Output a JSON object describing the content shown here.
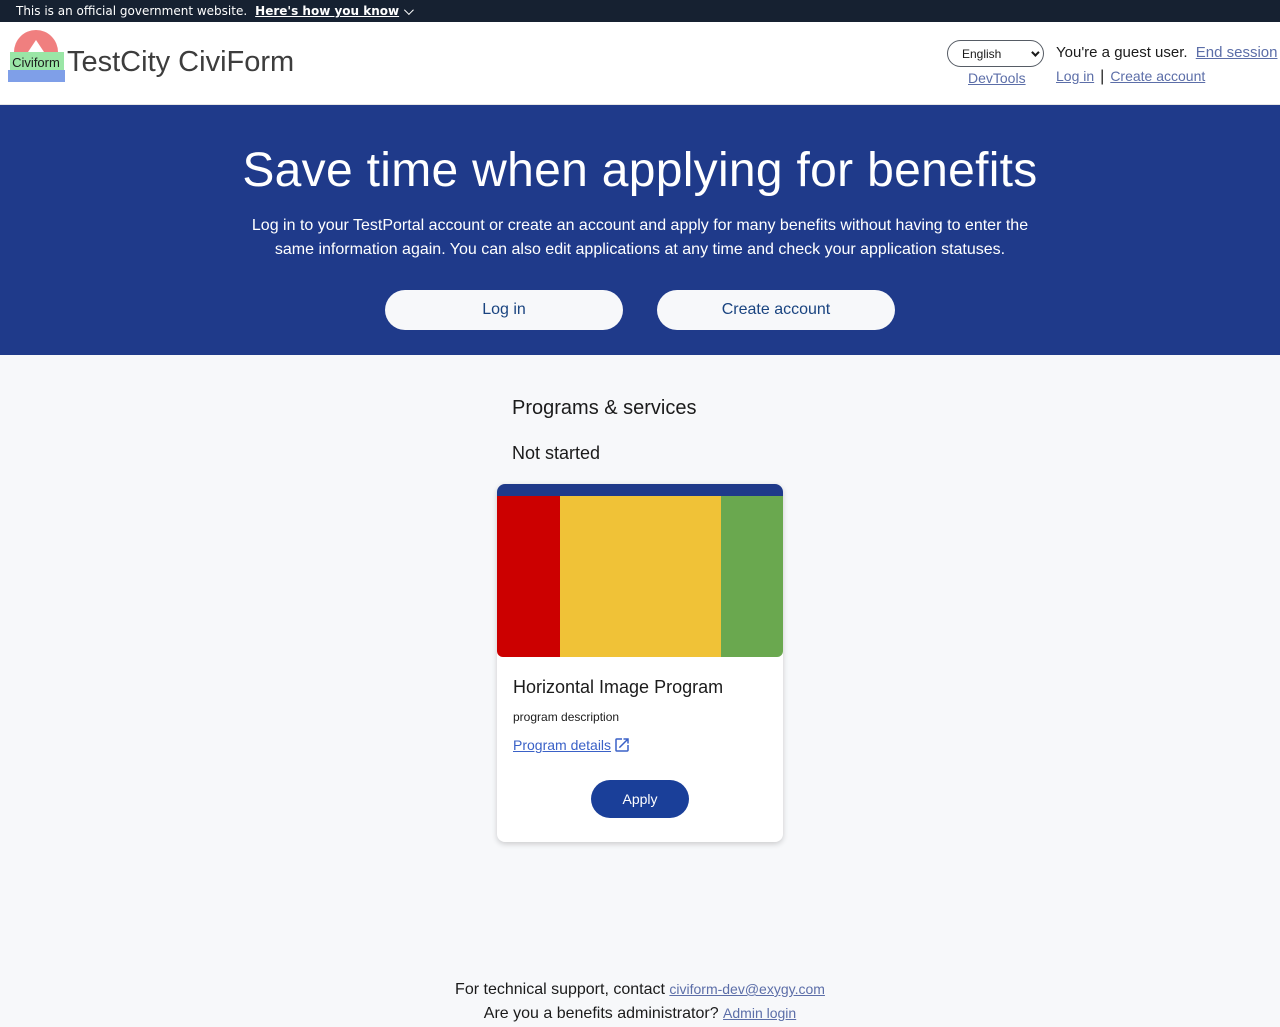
{
  "gov_banner": {
    "text": "This is an official government website.",
    "link": "Here's how you know",
    "link_icon": "chevron-down-icon"
  },
  "header": {
    "logo_label": "Civiform",
    "title": "TestCity CiviForm",
    "language": "English",
    "devtools": "DevTools",
    "guest_text": "You're a guest user.",
    "end_session": "End session",
    "login": "Log in",
    "separator": "|",
    "create_account": "Create account"
  },
  "hero": {
    "title": "Save time when applying for benefits",
    "description": "Log in to your TestPortal account or create an account and apply for many benefits without having to enter the same information again. You can also edit applications at any time and check your application statuses.",
    "login_button": "Log in",
    "create_button": "Create account",
    "background_color": "#1f3a8a"
  },
  "programs": {
    "section_title": "Programs & services",
    "status_title": "Not started",
    "cards": [
      {
        "name": "Horizontal Image Program",
        "description": "program description",
        "details_link": "Program details",
        "details_icon": "external-link-icon",
        "apply_button": "Apply",
        "image_colors": [
          "#cc0000",
          "#f0c237",
          "#6aa84f"
        ]
      }
    ]
  },
  "footer": {
    "support_text": "For technical support, contact",
    "support_email": "civiform-dev@exygy.com",
    "admin_text": "Are you a benefits administrator?",
    "admin_link": "Admin login"
  }
}
